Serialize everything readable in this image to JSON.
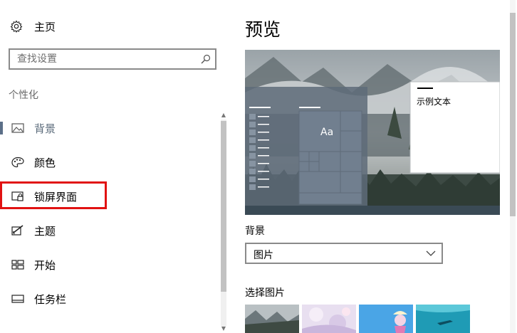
{
  "nav_home": {
    "label": "主页",
    "icon": "gear-icon"
  },
  "search": {
    "placeholder": "查找设置",
    "icon": "search-icon"
  },
  "section_title": "个性化",
  "nav_items": [
    {
      "label": "背景",
      "icon": "picture-icon",
      "selected": true
    },
    {
      "label": "颜色",
      "icon": "palette-icon"
    },
    {
      "label": "锁屏界面",
      "icon": "lock-screen-icon",
      "highlighted": true
    },
    {
      "label": "主题",
      "icon": "theme-brush-icon"
    },
    {
      "label": "开始",
      "icon": "start-menu-icon"
    },
    {
      "label": "任务栏",
      "icon": "taskbar-icon"
    }
  ],
  "preview": {
    "title": "预览",
    "tile_text": "Aa",
    "window_text": "示例文本"
  },
  "background_setting": {
    "label": "背景",
    "selected_value": "图片"
  },
  "choose_picture": {
    "label": "选择图片",
    "thumbnails": [
      "mountain-fog",
      "anime-pastel",
      "anime-blue-sky",
      "underwater-swimmer"
    ]
  },
  "colors": {
    "accent_highlight": "#e11212",
    "selection_bar": "#5c6f88",
    "tile_color": "#717f8f"
  }
}
